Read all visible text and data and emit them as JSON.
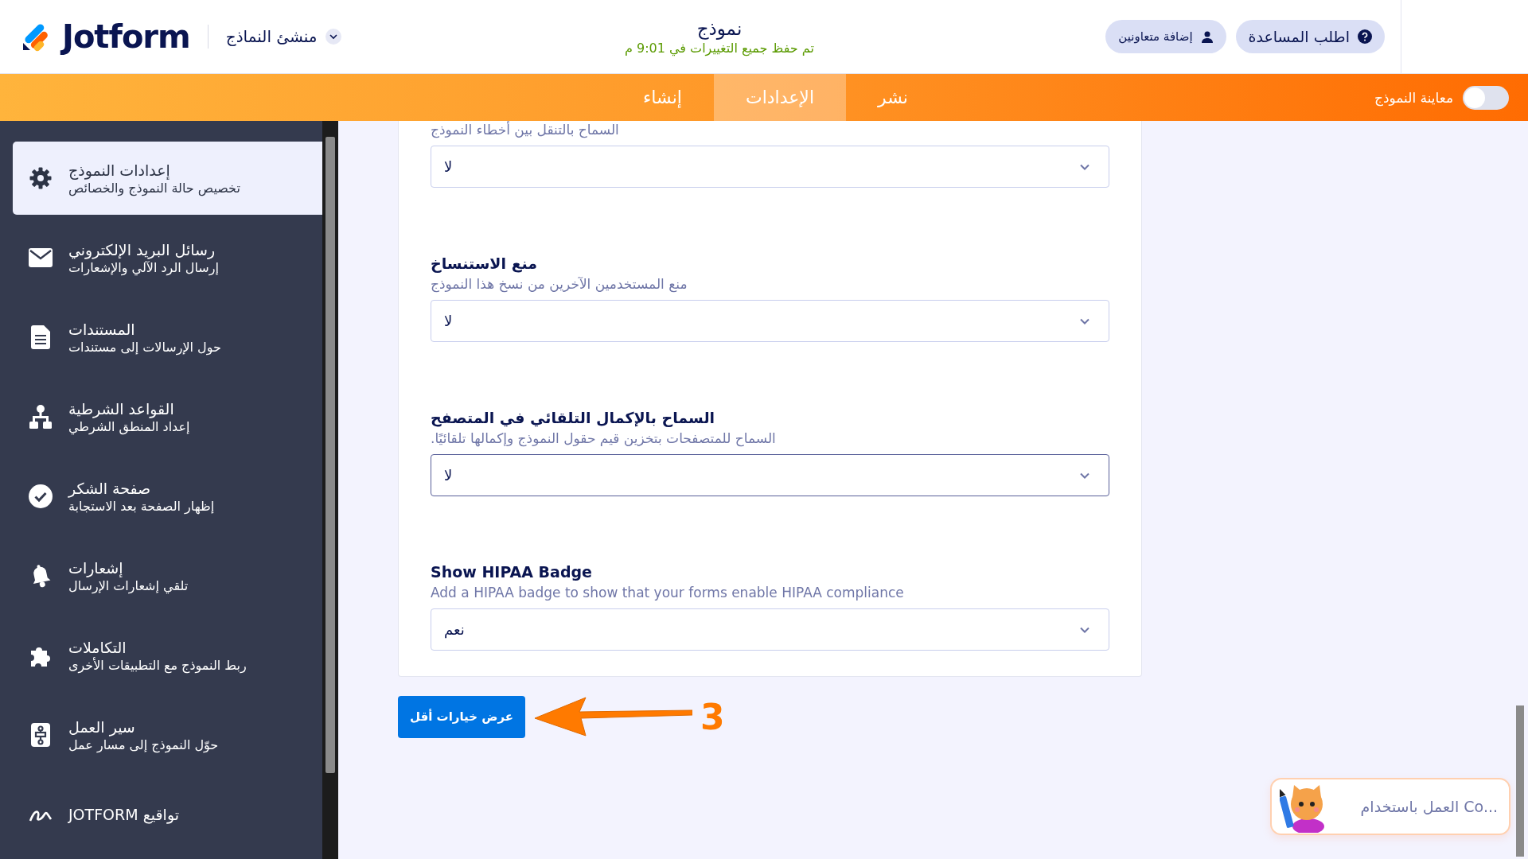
{
  "header": {
    "logo": "Jotform",
    "app_menu": "منشئ النماذج",
    "title": "نموذج",
    "save_status": "تم حفظ جميع التغييرات في 9:01 م",
    "buttons": [
      {
        "label": "اطلب المساعدة",
        "kind": "help"
      },
      {
        "label": "إضافة متعاونين",
        "kind": "collaborators"
      }
    ]
  },
  "nav": {
    "tabs": [
      {
        "label": "نشر",
        "selected": false
      },
      {
        "label": "الإعدادات",
        "selected": true
      },
      {
        "label": "إنشاء",
        "selected": false
      }
    ],
    "preview_toggle": {
      "label": "معاينة النموذج",
      "on": false
    }
  },
  "sidebar": {
    "items": [
      {
        "title": "إعدادات النموذج",
        "subtitle": "تخصيص حالة النموذج والخصائص",
        "selected": true
      },
      {
        "title": "رسائل البريد الإلكتروني",
        "subtitle": "إرسال الرد الآلي والإشعارات",
        "selected": false
      },
      {
        "title": "المستندات",
        "subtitle": "حول الإرسالات إلى مستندات",
        "selected": false
      },
      {
        "title": "القواعد الشرطية",
        "subtitle": "إعداد المنطق الشرطي",
        "selected": false
      },
      {
        "title": "صفحة الشكر",
        "subtitle": "إظهار الصفحة بعد الاستجابة",
        "selected": false
      },
      {
        "title": "إشعارات",
        "subtitle": "تلقي إشعارات الإرسال",
        "selected": false
      },
      {
        "title": "التكاملات",
        "subtitle": "ربط النموذج مع التطبيقات الأخرى",
        "selected": false
      },
      {
        "title": "سير العمل",
        "subtitle": "حوّل النموذج إلى مسار عمل",
        "selected": false
      },
      {
        "title": "تواقيع JOTFORM",
        "selected": false
      }
    ]
  },
  "settings": [
    {
      "description": "السماح بالتنقل بين أخطاء النموذج",
      "value": "لا",
      "focused": false
    },
    {
      "label": "منع الاستنساخ",
      "description": "منع المستخدمين الآخرين من نسخ هذا النموذج",
      "value": "لا",
      "focused": false
    },
    {
      "label": "السماح بالإكمال التلقائي في المتصفح",
      "description": "السماح للمتصفحات بتخزين قيم حقول النموذج وإكمالها تلقائيًا.",
      "value": "لا",
      "focused": true
    },
    {
      "label": "Show HIPAA Badge",
      "description": "Add a HIPAA badge to show that your forms enable HIPAA compliance",
      "value": "نعم",
      "focused": false
    }
  ],
  "show_less_button": "عرض خيارات أقل",
  "annotation": {
    "number": "3"
  },
  "chat_widget": {
    "text": "العمل باستخدام Co..."
  }
}
